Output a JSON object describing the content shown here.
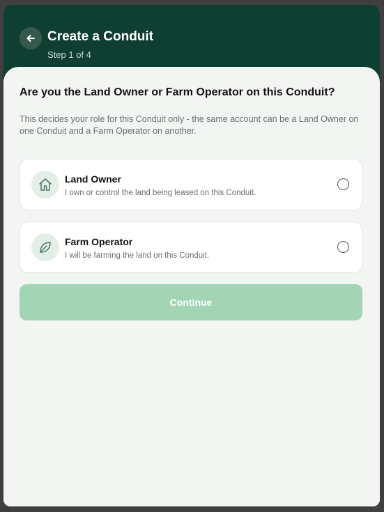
{
  "header": {
    "title": "Create a Conduit",
    "step": "Step 1 of 4"
  },
  "question": "Are you the Land Owner or Farm Operator on this Conduit?",
  "description": "This decides your role for this Conduit only - the same account can be a Land Owner on one Conduit and a Farm Operator on another.",
  "options": [
    {
      "title": "Land Owner",
      "subtitle": "I own or control the land being leased on this Conduit.",
      "icon": "house-icon",
      "selected": false
    },
    {
      "title": "Farm Operator",
      "subtitle": "I will be farming the land on this Conduit.",
      "icon": "leaf-icon",
      "selected": false
    }
  ],
  "continue_label": "Continue",
  "colors": {
    "header_bg": "#0f3f32",
    "sheet_bg": "#f3f5f2",
    "button_disabled": "#a3d4b4",
    "icon_bg": "#e3efe6"
  }
}
